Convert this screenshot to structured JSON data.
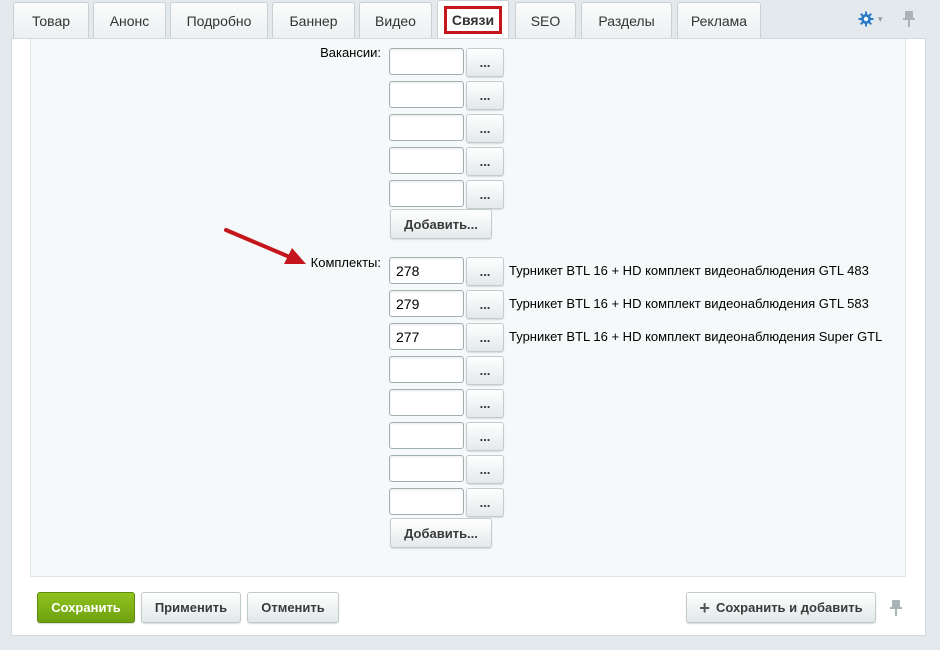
{
  "tabs": [
    {
      "label": "Товар"
    },
    {
      "label": "Анонс"
    },
    {
      "label": "Подробно"
    },
    {
      "label": "Баннер"
    },
    {
      "label": "Видео"
    },
    {
      "label": "Связи"
    },
    {
      "label": "SEO"
    },
    {
      "label": "Разделы"
    },
    {
      "label": "Реклама"
    }
  ],
  "active_tab": "Связи",
  "settings_icon": "gear-icon",
  "pin_icon": "pin-icon",
  "vacancies": {
    "label": "Вакансии:",
    "rows": [
      {
        "value": "",
        "button": "..."
      },
      {
        "value": "",
        "button": "..."
      },
      {
        "value": "",
        "button": "..."
      },
      {
        "value": "",
        "button": "..."
      },
      {
        "value": "",
        "button": "..."
      }
    ],
    "add_label": "Добавить..."
  },
  "kits": {
    "label": "Комплекты:",
    "rows": [
      {
        "value": "278",
        "button": "...",
        "name": "Турникет BTL 16 + HD комплект видеонаблюдения GTL 483"
      },
      {
        "value": "279",
        "button": "...",
        "name": "Турникет BTL 16 + HD комплект видеонаблюдения GTL 583"
      },
      {
        "value": "277",
        "button": "...",
        "name": "Турникет BTL 16 + HD комплект видеонаблюдения Super GTL"
      },
      {
        "value": "",
        "button": "...",
        "name": ""
      },
      {
        "value": "",
        "button": "...",
        "name": ""
      },
      {
        "value": "",
        "button": "...",
        "name": ""
      },
      {
        "value": "",
        "button": "...",
        "name": ""
      },
      {
        "value": "",
        "button": "...",
        "name": ""
      }
    ],
    "add_label": "Добавить..."
  },
  "footer": {
    "save_label": "Сохранить",
    "apply_label": "Применить",
    "cancel_label": "Отменить",
    "save_add_label": "Сохранить и добавить"
  },
  "colors": {
    "accent": "#2c7bc9",
    "highlight": "#c4161c",
    "primary_button": "#7cb315"
  }
}
